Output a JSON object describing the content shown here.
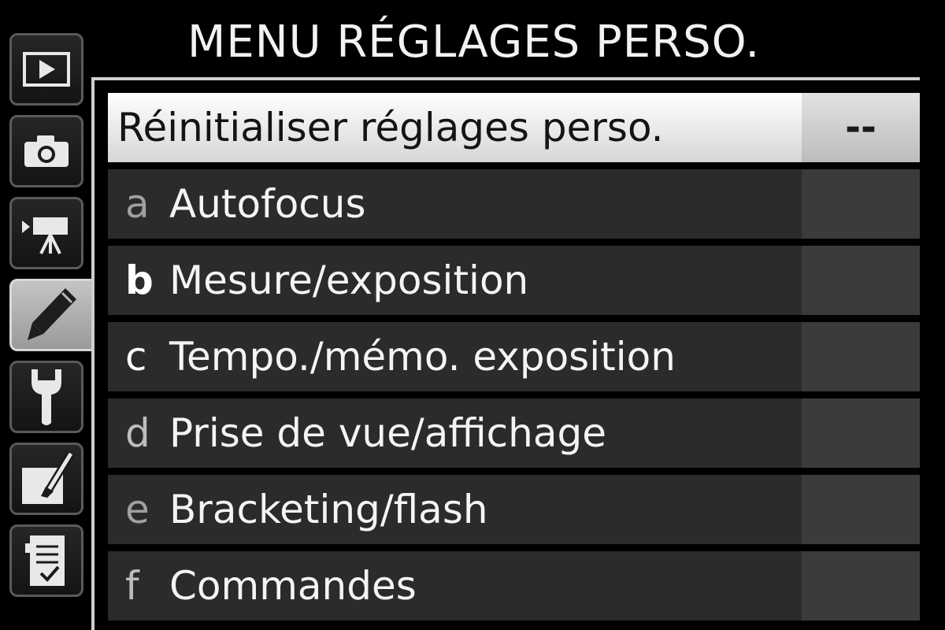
{
  "title": "MENU RÉGLAGES PERSO.",
  "tabs": [
    {
      "icon": "playback-icon",
      "active": false
    },
    {
      "icon": "camera-icon",
      "active": false
    },
    {
      "icon": "movie-camera-icon",
      "active": false
    },
    {
      "icon": "pencil-icon",
      "active": true
    },
    {
      "icon": "wrench-icon",
      "active": false
    },
    {
      "icon": "retouch-icon",
      "active": false
    },
    {
      "icon": "recent-settings-icon",
      "active": false
    }
  ],
  "menu": {
    "items": [
      {
        "letter": "",
        "label": "Réinitialiser réglages perso.",
        "value": "--",
        "selected": true
      },
      {
        "letter": "a",
        "label": "Autofocus",
        "value": ""
      },
      {
        "letter": "b",
        "label": "Mesure/exposition",
        "value": ""
      },
      {
        "letter": "c",
        "label": "Tempo./mémo. exposition",
        "value": ""
      },
      {
        "letter": "d",
        "label": "Prise de vue/affichage",
        "value": ""
      },
      {
        "letter": "e",
        "label": "Bracketing/flash",
        "value": ""
      },
      {
        "letter": "f",
        "label": "Commandes",
        "value": ""
      }
    ]
  },
  "colors": {
    "background": "#000000",
    "row": "#2b2b2b",
    "value_cell": "#3b3b3b",
    "selected_row": "#ffffff",
    "active_tab": "#b8b8b8"
  }
}
